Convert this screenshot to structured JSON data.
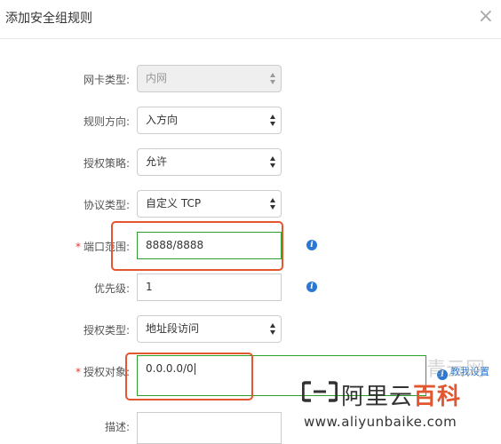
{
  "dialog": {
    "title": "添加安全组规则",
    "close_glyph": "×"
  },
  "form": {
    "nic_type": {
      "label": "网卡类型:",
      "value": "内网"
    },
    "direction": {
      "label": "规则方向:",
      "value": "入方向"
    },
    "policy": {
      "label": "授权策略:",
      "value": "允许"
    },
    "protocol": {
      "label": "协议类型:",
      "value": "自定义 TCP"
    },
    "port_range": {
      "label": "端口范围:",
      "required_mark": "*",
      "value": "8888/8888"
    },
    "priority": {
      "label": "优先级:",
      "value": "1"
    },
    "auth_type": {
      "label": "授权类型:",
      "value": "地址段访问"
    },
    "auth_object": {
      "label": "授权对象:",
      "required_mark": "*",
      "value": "0.0.0.0/0",
      "help_link": "教我设置"
    },
    "description": {
      "label": "描述:",
      "value": ""
    }
  },
  "icons": {
    "info": "info-icon",
    "close": "close-icon",
    "select_arrows": "select-arrows-icon",
    "logo": "aliyun-logo-icon"
  },
  "watermark": {
    "qingyun": "青云网",
    "brand_prefix": "阿里云",
    "brand_highlight": "百科",
    "url": "www.aliyunbaike.com"
  },
  "colors": {
    "accent_blue": "#2a78d1",
    "annotation_red": "#e2572f",
    "required_red": "#e53935",
    "focus_green": "#2ca02c"
  }
}
